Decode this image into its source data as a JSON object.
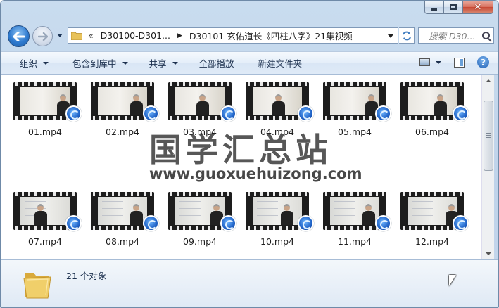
{
  "window": {
    "caption_minimize": "—",
    "caption_maximize": "□",
    "caption_close": "✕"
  },
  "address": {
    "overflow_glyph": "«",
    "crumbs": [
      "D30100-D301...",
      "D30101 玄佑道长《四柱八字》21集视频"
    ],
    "separator": "▶"
  },
  "search": {
    "placeholder": "搜索 D30..."
  },
  "toolbar": {
    "organize": "组织",
    "include_in_library": "包含到库中",
    "share": "共享",
    "play_all": "全部播放",
    "new_folder": "新建文件夹",
    "help": "?"
  },
  "files": [
    {
      "name": "01.mp4",
      "scene": "plain"
    },
    {
      "name": "02.mp4",
      "scene": "plain"
    },
    {
      "name": "03.mp4",
      "scene": "plain"
    },
    {
      "name": "04.mp4",
      "scene": "plain"
    },
    {
      "name": "05.mp4",
      "scene": "plain"
    },
    {
      "name": "06.mp4",
      "scene": "plain"
    },
    {
      "name": "07.mp4",
      "scene": "board"
    },
    {
      "name": "08.mp4",
      "scene": "board"
    },
    {
      "name": "09.mp4",
      "scene": "board"
    },
    {
      "name": "10.mp4",
      "scene": "board"
    },
    {
      "name": "11.mp4",
      "scene": "board"
    },
    {
      "name": "12.mp4",
      "scene": "board"
    }
  ],
  "watermark": {
    "chinese": "国学汇总站",
    "url": "www.guoxuehuizong.com"
  },
  "details": {
    "item_count": "21 个对象"
  },
  "colors": {
    "accent": "#2f7bd0",
    "folder": "#e8c25a"
  }
}
